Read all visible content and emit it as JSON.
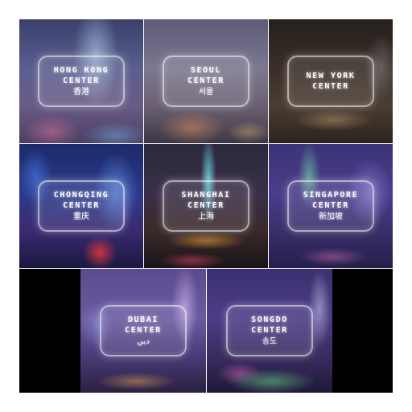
{
  "tiles": [
    {
      "line1": "HONG KONG",
      "line2": "CENTER",
      "native": "香港"
    },
    {
      "line1": "SEOUL",
      "line2": "CENTER",
      "native": "서울"
    },
    {
      "line1": "NEW YORK",
      "line2": "CENTER",
      "native": ""
    },
    {
      "line1": "CHONGQING",
      "line2": "CENTER",
      "native": "重庆"
    },
    {
      "line1": "SHANGHAI",
      "line2": "CENTER",
      "native": "上海"
    },
    {
      "line1": "SINGAPORE",
      "line2": "CENTER",
      "native": "新加坡"
    },
    {
      "line1": "DUBAI",
      "line2": "CENTER",
      "native": "دبي"
    },
    {
      "line1": "SONGDO",
      "line2": "CENTER",
      "native": "송도"
    }
  ]
}
